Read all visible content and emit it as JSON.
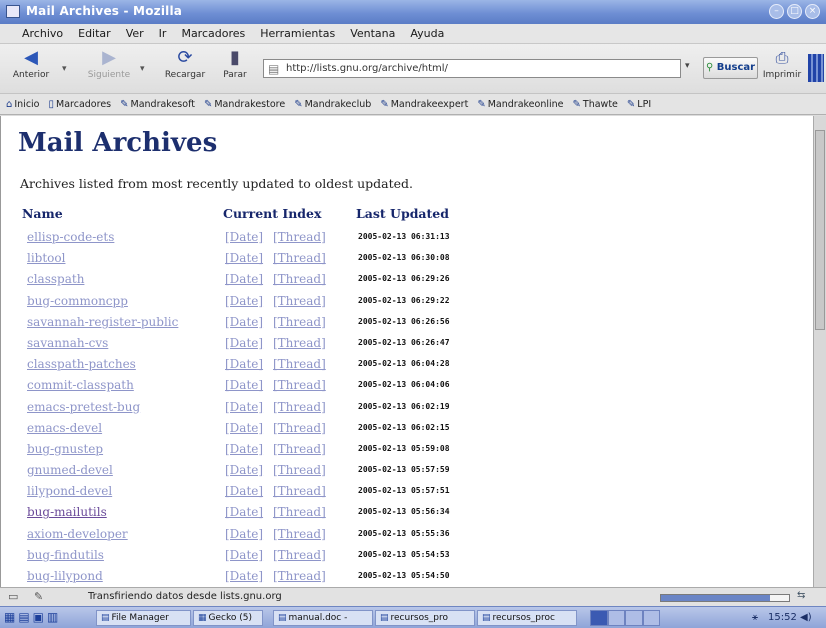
{
  "window": {
    "title": "Mail Archives - Mozilla"
  },
  "menubar": [
    "Archivo",
    "Editar",
    "Ver",
    "Ir",
    "Marcadores",
    "Herramientas",
    "Ventana",
    "Ayuda"
  ],
  "nav": {
    "back": "Anterior",
    "forward": "Siguiente",
    "reload": "Recargar",
    "stop": "Parar",
    "url": "http://lists.gnu.org/archive/html/",
    "search": "Buscar",
    "print": "Imprimir"
  },
  "bookmarks": [
    "Inicio",
    "Marcadores",
    "Mandrakesoft",
    "Mandrakestore",
    "Mandrakeclub",
    "Mandrakeexpert",
    "Mandrakeonline",
    "Thawte",
    "LPI"
  ],
  "page": {
    "title": "Mail Archives",
    "subtitle": "Archives listed from most recently updated to oldest updated.",
    "headers": {
      "name": "Name",
      "index": "Current Index",
      "updated": "Last Updated"
    },
    "date_label": "[Date]",
    "thread_label": "[Thread]",
    "rows": [
      {
        "name": "ellisp-code-ets",
        "updated": "2005-02-13 06:31:13"
      },
      {
        "name": "libtool",
        "updated": "2005-02-13 06:30:08"
      },
      {
        "name": "classpath",
        "updated": "2005-02-13 06:29:26"
      },
      {
        "name": "bug-commoncpp",
        "updated": "2005-02-13 06:29:22"
      },
      {
        "name": "savannah-register-public",
        "updated": "2005-02-13 06:26:56"
      },
      {
        "name": "savannah-cvs",
        "updated": "2005-02-13 06:26:47"
      },
      {
        "name": "classpath-patches",
        "updated": "2005-02-13 06:04:28"
      },
      {
        "name": "commit-classpath",
        "updated": "2005-02-13 06:04:06"
      },
      {
        "name": "emacs-pretest-bug",
        "updated": "2005-02-13 06:02:19"
      },
      {
        "name": "emacs-devel",
        "updated": "2005-02-13 06:02:15"
      },
      {
        "name": "bug-gnustep",
        "updated": "2005-02-13 05:59:08"
      },
      {
        "name": "gnumed-devel",
        "updated": "2005-02-13 05:57:59"
      },
      {
        "name": "lilypond-devel",
        "updated": "2005-02-13 05:57:51"
      },
      {
        "name": "bug-mailutils",
        "updated": "2005-02-13 05:56:34"
      },
      {
        "name": "axiom-developer",
        "updated": "2005-02-13 05:55:36"
      },
      {
        "name": "bug-findutils",
        "updated": "2005-02-13 05:54:53"
      },
      {
        "name": "bug-lilypond",
        "updated": "2005-02-13 05:54:50"
      }
    ]
  },
  "status": {
    "text": "Transfiriendo datos desde lists.gnu.org",
    "progress": 0.85
  },
  "taskbar": {
    "tasks": [
      "File Manager",
      "Gecko (5)",
      "manual.doc -",
      "recursos_pro",
      "recursos_proc"
    ],
    "clock": "15:52"
  }
}
